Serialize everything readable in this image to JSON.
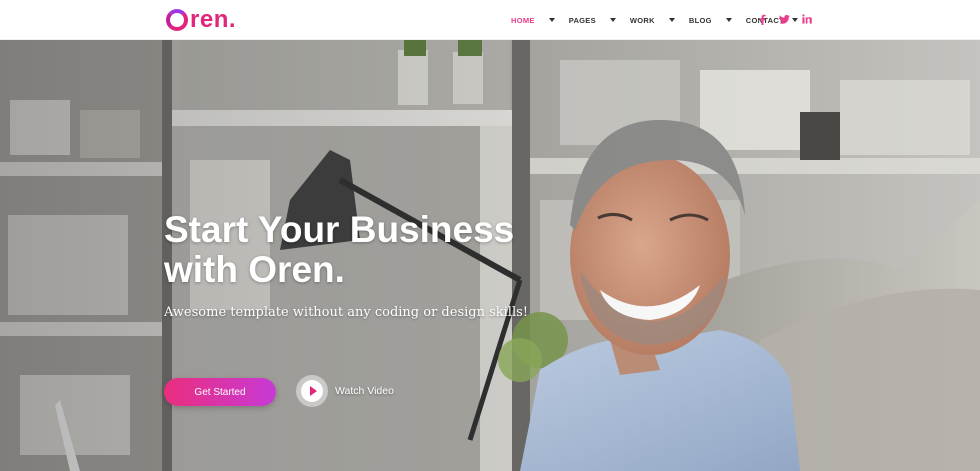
{
  "brand": {
    "name": "ren.",
    "accent": "#e0267a",
    "gradient_end": "#c73ad6"
  },
  "nav": {
    "items": [
      {
        "label": "HOME",
        "active": true
      },
      {
        "label": "PAGES",
        "active": false
      },
      {
        "label": "WORK",
        "active": false
      },
      {
        "label": "BLOG",
        "active": false
      },
      {
        "label": "CONTACT",
        "active": false
      }
    ],
    "social": [
      {
        "icon": "facebook-icon",
        "glyph": "f"
      },
      {
        "icon": "twitter-icon",
        "glyph": "t"
      },
      {
        "icon": "linkedin-icon",
        "glyph": "in"
      }
    ]
  },
  "hero": {
    "title_line1": "Start Your Business",
    "title_line2": "with Oren.",
    "subtitle": "Awesome template without any coding or design skills!",
    "cta_label": "Get Started",
    "video_label": "Watch Video",
    "image": "smiling-man-in-office"
  }
}
